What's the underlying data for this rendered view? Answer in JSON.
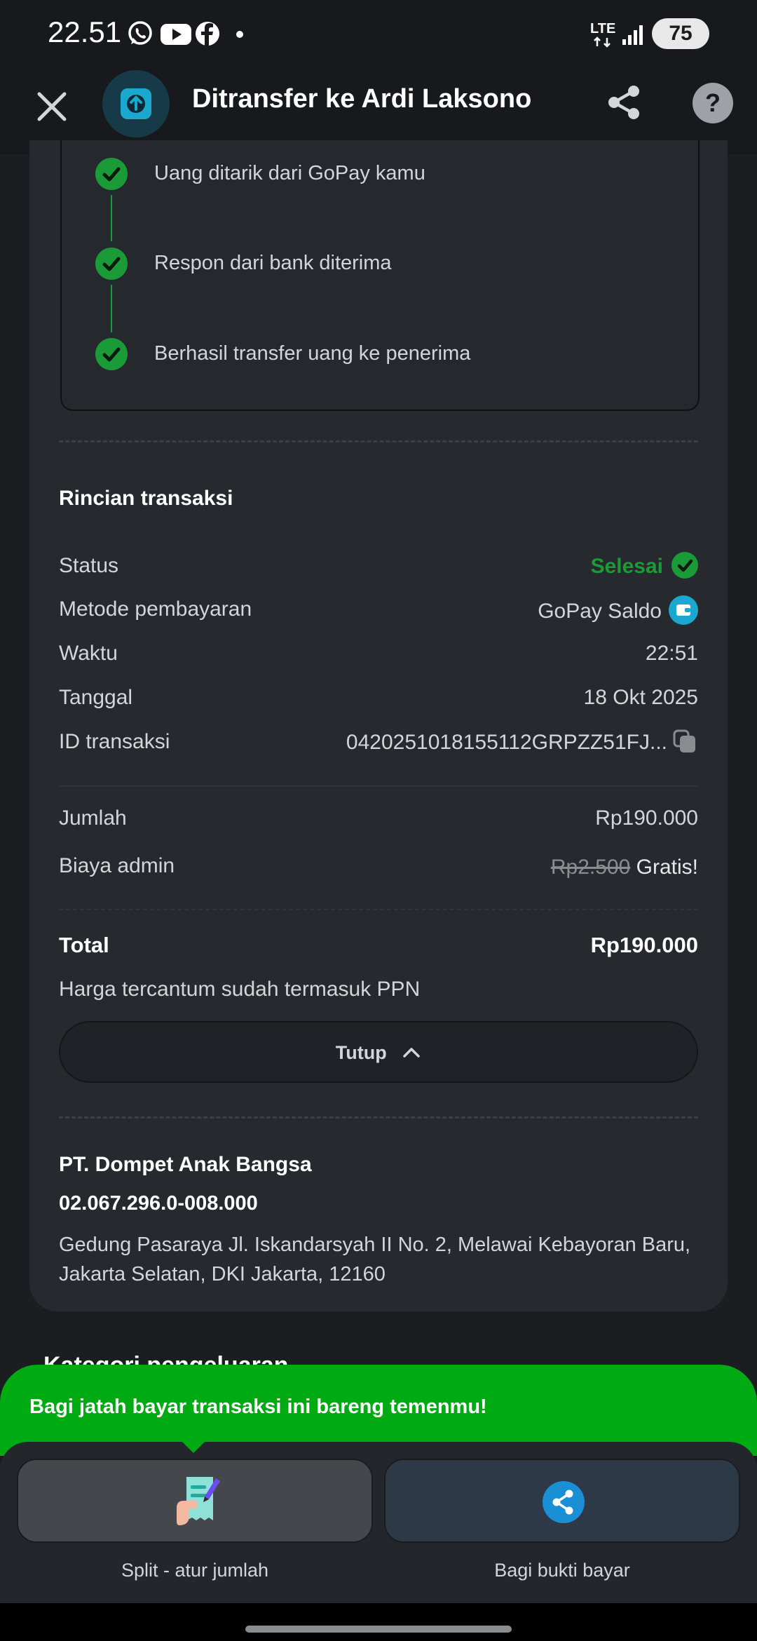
{
  "status_bar": {
    "time": "22.51",
    "network": "LTE",
    "battery": "75",
    "icons": [
      "whatsapp-icon",
      "youtube-icon",
      "facebook-icon",
      "dot-icon",
      "lte-icon",
      "signal-icon",
      "battery-icon"
    ]
  },
  "header": {
    "title": "Ditransfer ke Ardi Laksono",
    "close_icon": "close-icon",
    "share_icon": "share-icon",
    "help_label": "?"
  },
  "timeline": [
    {
      "label": "Uang ditarik dari GoPay kamu"
    },
    {
      "label": "Respon dari bank diterima"
    },
    {
      "label": "Berhasil transfer uang ke penerima"
    }
  ],
  "details": {
    "title": "Rincian transaksi",
    "status_label": "Status",
    "status_value": "Selesai",
    "method_label": "Metode pembayaran",
    "method_value": "GoPay Saldo",
    "time_label": "Waktu",
    "time_value": "22:51",
    "date_label": "Tanggal",
    "date_value": "18 Okt 2025",
    "id_label": "ID transaksi",
    "id_value": "0420251018155112GRPZZ51FJ...",
    "amount_label": "Jumlah",
    "amount_value": "Rp190.000",
    "fee_label": "Biaya admin",
    "fee_original": "Rp2.500",
    "fee_value": "Gratis!",
    "total_label": "Total",
    "total_value": "Rp190.000",
    "tax_note": "Harga tercantum sudah termasuk PPN",
    "collapse_label": "Tutup"
  },
  "company": {
    "name": "PT. Dompet Anak Bangsa",
    "npwp": "02.067.296.0-008.000",
    "address": "Gedung Pasaraya Jl. Iskandarsyah II No. 2, Melawai Kebayoran Baru, Jakarta Selatan, DKI Jakarta, 12160"
  },
  "hidden_section_title": "Kategori pengeluaran",
  "promo": {
    "text": "Bagi jatah bayar transaksi ini bareng temenmu!"
  },
  "actions": [
    {
      "label": "Split - atur jumlah",
      "icon": "receipt-split-icon"
    },
    {
      "label": "Bagi bukti bayar",
      "icon": "share-icon"
    }
  ],
  "colors": {
    "accent_green": "#00aa13",
    "success_green": "#1a9b38",
    "gopay_blue": "#1aa8cf",
    "background": "#1b1e21",
    "card": "#262a2e"
  }
}
